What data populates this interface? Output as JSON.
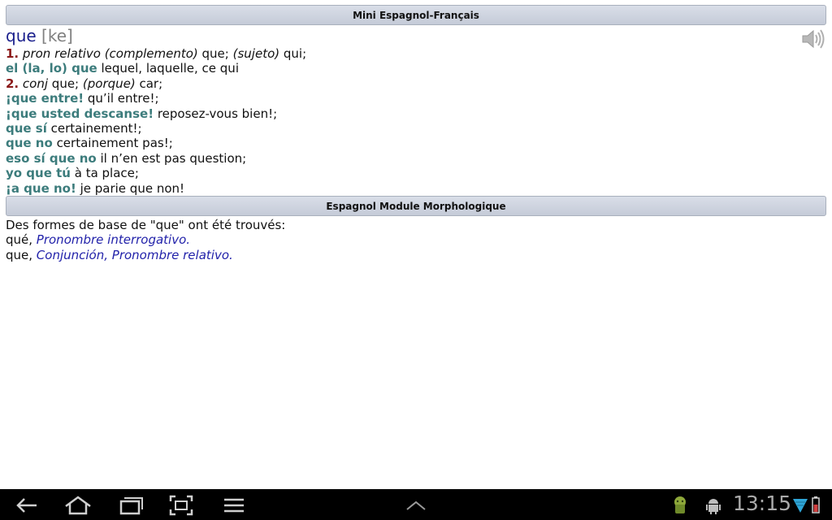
{
  "header1": {
    "title": "Mini Espagnol-Français"
  },
  "entry": {
    "headword": "que",
    "pronunciation": "[ke]",
    "sense1": {
      "num": "1.",
      "pos": "pron relativo (complemento)",
      "t1": " que; ",
      "label2": "(sujeto)",
      "t2": " qui;"
    },
    "line2": {
      "ex": "el (la, lo) que",
      "tr": " lequel, laquelle, ce qui"
    },
    "sense2": {
      "num": "2.",
      "pos": "conj",
      "t1": " que; ",
      "label2": "(porque)",
      "t2": " car;"
    },
    "examples": [
      {
        "ex": "¡que entre!",
        "tr": " qu’il entre!;"
      },
      {
        "ex": "¡que usted descanse!",
        "tr": " reposez-vous bien!;"
      },
      {
        "ex": "que sí",
        "tr": " certainement!;"
      },
      {
        "ex": "que no",
        "tr": " certainement pas!;"
      },
      {
        "ex": "eso sí que no",
        "tr": " il n’en est pas question;"
      },
      {
        "ex": "yo que tú",
        "tr": " à ta place;"
      },
      {
        "ex": "¡a que no!",
        "tr": " je parie que non!"
      }
    ]
  },
  "header2": {
    "title": "Espagnol Module Morphologique"
  },
  "morph": {
    "intro": "Des formes de base de \"que\" ont été trouvés:",
    "rows": [
      {
        "word": "qué, ",
        "link": "Pronombre interrogativo."
      },
      {
        "word": "que, ",
        "link": "Conjunción, Pronombre relativo."
      }
    ]
  },
  "statusbar": {
    "time": "13:15"
  },
  "icons": {
    "speaker": "speaker-icon",
    "back": "back-icon",
    "home": "home-icon",
    "recent": "recent-apps-icon",
    "screenshot": "screenshot-icon",
    "menu": "menu-icon",
    "up": "chevron-up-icon"
  },
  "colors": {
    "headword": "#1a1f8c",
    "example": "#3c7c7c",
    "number": "#8b1a1a",
    "link": "#2222aa",
    "header_bg": "#cfd5e1"
  }
}
